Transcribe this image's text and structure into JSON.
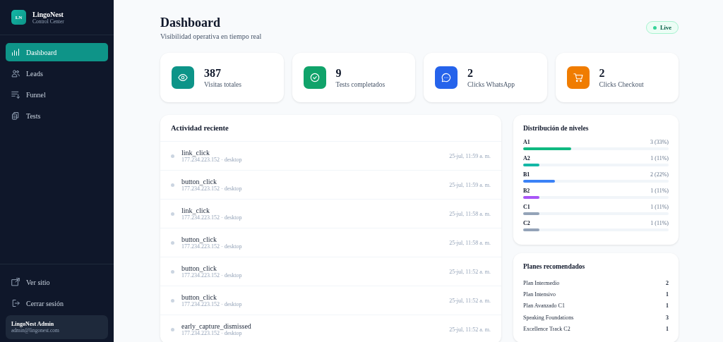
{
  "sidebar": {
    "logo": "LN",
    "brand": "LingoNest",
    "subtitle": "Control Center",
    "items": [
      {
        "label": "Dashboard",
        "selected": true
      },
      {
        "label": "Leads",
        "selected": false
      },
      {
        "label": "Funnel",
        "selected": false
      },
      {
        "label": "Tests",
        "selected": false
      }
    ],
    "footer_items": [
      {
        "label": "Ver sitio"
      },
      {
        "label": "Cerrar sesión"
      }
    ],
    "user": {
      "name": "LingoNest Admin",
      "email": "admin@lingonest.com"
    }
  },
  "header": {
    "title": "Dashboard",
    "subtitle": "Visibilidad operativa en tiempo real",
    "badge": "Live"
  },
  "stats": [
    {
      "value": "387",
      "label": "Visitas totales",
      "color": "#0d9488"
    },
    {
      "value": "9",
      "label": "Tests completados",
      "color": "#10a36a"
    },
    {
      "value": "2",
      "label": "Clicks WhatsApp",
      "color": "#2563eb"
    },
    {
      "value": "2",
      "label": "Clicks Checkout",
      "color": "#f07c00"
    }
  ],
  "activity": {
    "title": "Actividad reciente",
    "rows": [
      {
        "event": "link_click",
        "meta": "177.234.223.152 · desktop",
        "time": "25-jul, 11:59 a. m."
      },
      {
        "event": "button_click",
        "meta": "177.234.223.152 · desktop",
        "time": "25-jul, 11:59 a. m."
      },
      {
        "event": "link_click",
        "meta": "177.234.223.152 · desktop",
        "time": "25-jul, 11:58 a. m."
      },
      {
        "event": "button_click",
        "meta": "177.234.223.152 · desktop",
        "time": "25-jul, 11:58 a. m."
      },
      {
        "event": "button_click",
        "meta": "177.234.223.152 · desktop",
        "time": "25-jul, 11:52 a. m."
      },
      {
        "event": "button_click",
        "meta": "177.234.223.152 · desktop",
        "time": "25-jul, 11:52 a. m."
      },
      {
        "event": "early_capture_dismissed",
        "meta": "177.234.223.152 · desktop",
        "time": "25-jul, 11:52 a. m."
      }
    ]
  },
  "levels": {
    "title": "Distribución de niveles",
    "items": [
      {
        "name": "A1",
        "reading": "3 (33%)",
        "level": 0.33,
        "color": "#10b981"
      },
      {
        "name": "A2",
        "reading": "1 (11%)",
        "level": 0.11,
        "color": "#14b8a6"
      },
      {
        "name": "B1",
        "reading": "2 (22%)",
        "level": 0.22,
        "color": "#3b82f6"
      },
      {
        "name": "B2",
        "reading": "1 (11%)",
        "level": 0.11,
        "color": "#a855f7"
      },
      {
        "name": "C1",
        "reading": "1 (11%)",
        "level": 0.11,
        "color": "#94a3b8"
      },
      {
        "name": "C2",
        "reading": "1 (11%)",
        "level": 0.11,
        "color": "#94a3b8"
      }
    ]
  },
  "plans": {
    "title": "Planes recomendados",
    "items": [
      {
        "name": "Plan Intermedio",
        "count": "2"
      },
      {
        "name": "Plan Intensivo",
        "count": "1"
      },
      {
        "name": "Plan Avanzado C1",
        "count": "1"
      },
      {
        "name": "Speaking Foundations",
        "count": "3"
      },
      {
        "name": "Excellence Track C2",
        "count": "1"
      }
    ]
  }
}
